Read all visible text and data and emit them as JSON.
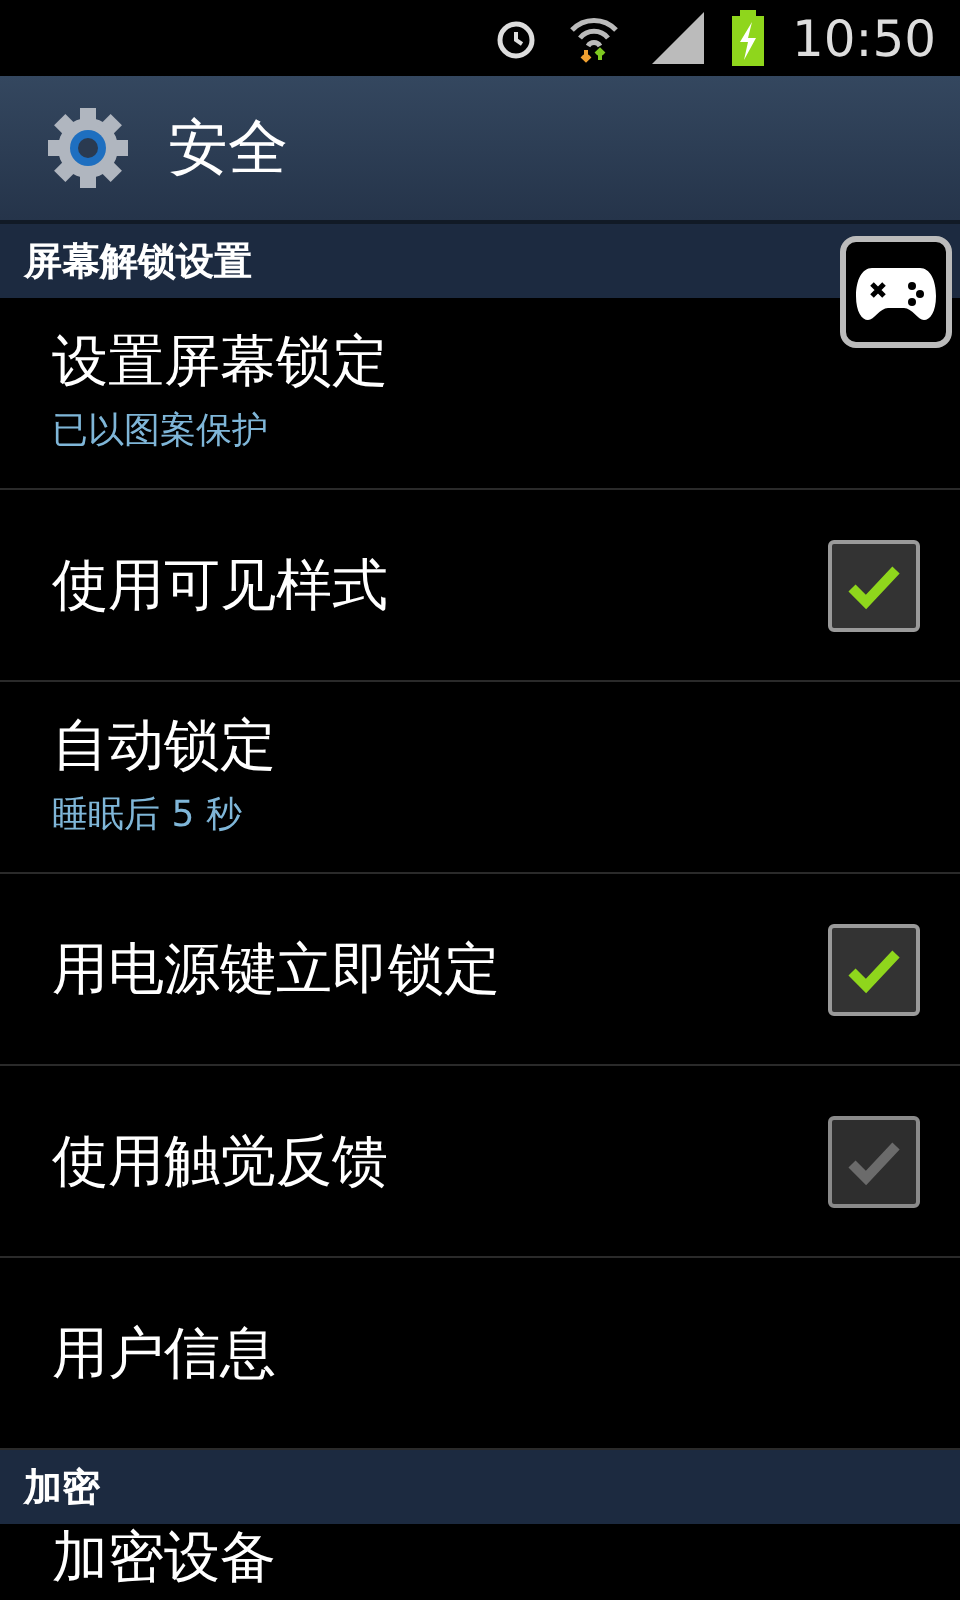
{
  "status_bar": {
    "time": "10:50"
  },
  "header": {
    "title": "安全"
  },
  "sections": [
    {
      "title": "屏幕解锁设置",
      "items": [
        {
          "kind": "plain",
          "title": "设置屏幕锁定",
          "summary": "已以图案保护"
        },
        {
          "kind": "check",
          "title": "使用可见样式",
          "checked": true,
          "disabled": false
        },
        {
          "kind": "plain",
          "title": "自动锁定",
          "summary": "睡眠后 5 秒"
        },
        {
          "kind": "check",
          "title": "用电源键立即锁定",
          "checked": true,
          "disabled": false
        },
        {
          "kind": "check",
          "title": "使用触觉反馈",
          "checked": true,
          "disabled": true
        },
        {
          "kind": "plain",
          "title": "用户信息"
        }
      ]
    },
    {
      "title": "加密",
      "items": [
        {
          "kind": "plain",
          "title": "加密设备"
        }
      ]
    }
  ]
}
